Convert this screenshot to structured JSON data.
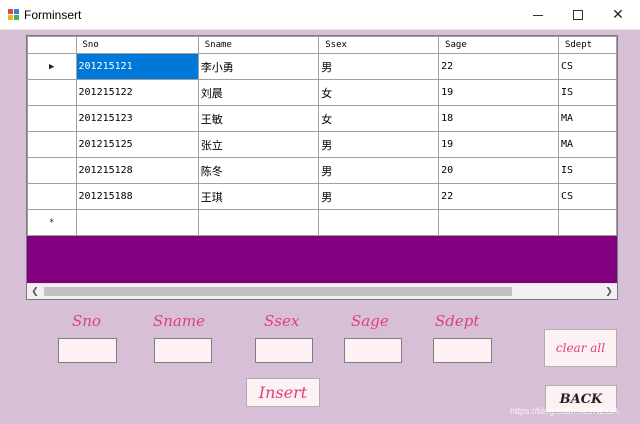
{
  "window": {
    "title": "Forminsert"
  },
  "grid": {
    "columns": [
      "Sno",
      "Sname",
      "Ssex",
      "Sage",
      "Sdept"
    ],
    "rows": [
      [
        "201215121",
        "李小勇",
        "男",
        "22",
        "CS"
      ],
      [
        "201215122",
        "刘晨",
        "女",
        "19",
        "IS"
      ],
      [
        "201215123",
        "王敏",
        "女",
        "18",
        "MA"
      ],
      [
        "201215125",
        "张立",
        "男",
        "19",
        "MA"
      ],
      [
        "201215128",
        "陈冬",
        "男",
        "20",
        "IS"
      ],
      [
        "201215188",
        "王琪",
        "男",
        "22",
        "CS"
      ]
    ],
    "current_row_marker": "▶",
    "new_row_marker": "*",
    "background_color": "#800080",
    "selection_color": "#0078d7"
  },
  "form": {
    "labels": {
      "sno": "Sno",
      "sname": "Sname",
      "ssex": "Ssex",
      "sage": "Sage",
      "sdept": "Sdept"
    },
    "values": {
      "sno": "",
      "sname": "",
      "ssex": "",
      "sage": "",
      "sdept": ""
    }
  },
  "buttons": {
    "insert": "Insert",
    "clear_all": "clear all",
    "back": "BACK"
  },
  "watermark": "https://blog.csdn.net/NEGA",
  "colors": {
    "form_background": "#d8bfd8",
    "label_color": "#e0407a"
  }
}
